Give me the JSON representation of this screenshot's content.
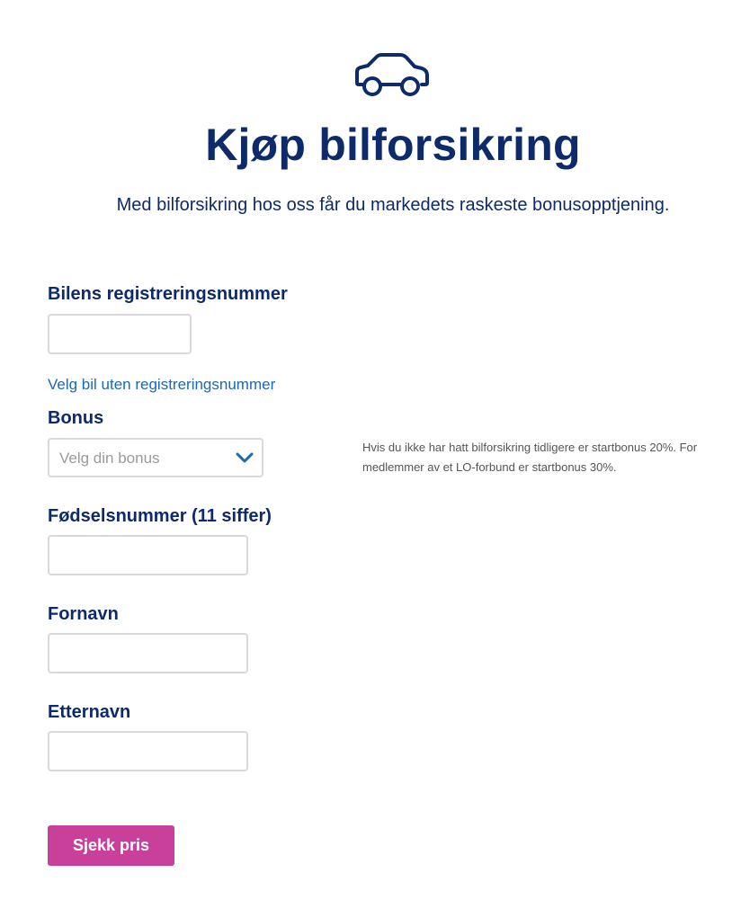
{
  "header": {
    "icon": "car-icon",
    "title": "Kjøp bilforsikring",
    "intro": "Med bilforsikring hos oss får du markedets raskeste bonusopptjening."
  },
  "form": {
    "registration": {
      "label": "Bilens registreringsnummer",
      "value": "",
      "placeholder": ""
    },
    "no_registration_link": "Velg bil uten registreringsnummer",
    "bonus": {
      "label": "Bonus",
      "selected": "Velg din bonus",
      "icon": "chevron-down-icon",
      "help_text": "Hvis du ikke har hatt bilforsikring tidligere er startbonus 20%. For medlemmer av et LO-forbund er startbonus 30%."
    },
    "birth_number": {
      "label": "Fødselsnummer (11 siffer)",
      "value": "",
      "placeholder": ""
    },
    "first_name": {
      "label": "Fornavn",
      "value": "",
      "placeholder": ""
    },
    "last_name": {
      "label": "Etternavn",
      "value": "",
      "placeholder": ""
    },
    "submit_label": "Sjekk pris"
  },
  "colors": {
    "primary_text": "#0d2a6b",
    "link": "#1b68b3",
    "button": "#c9409a",
    "help_text": "#555555",
    "input_border": "#d9d9d9"
  }
}
